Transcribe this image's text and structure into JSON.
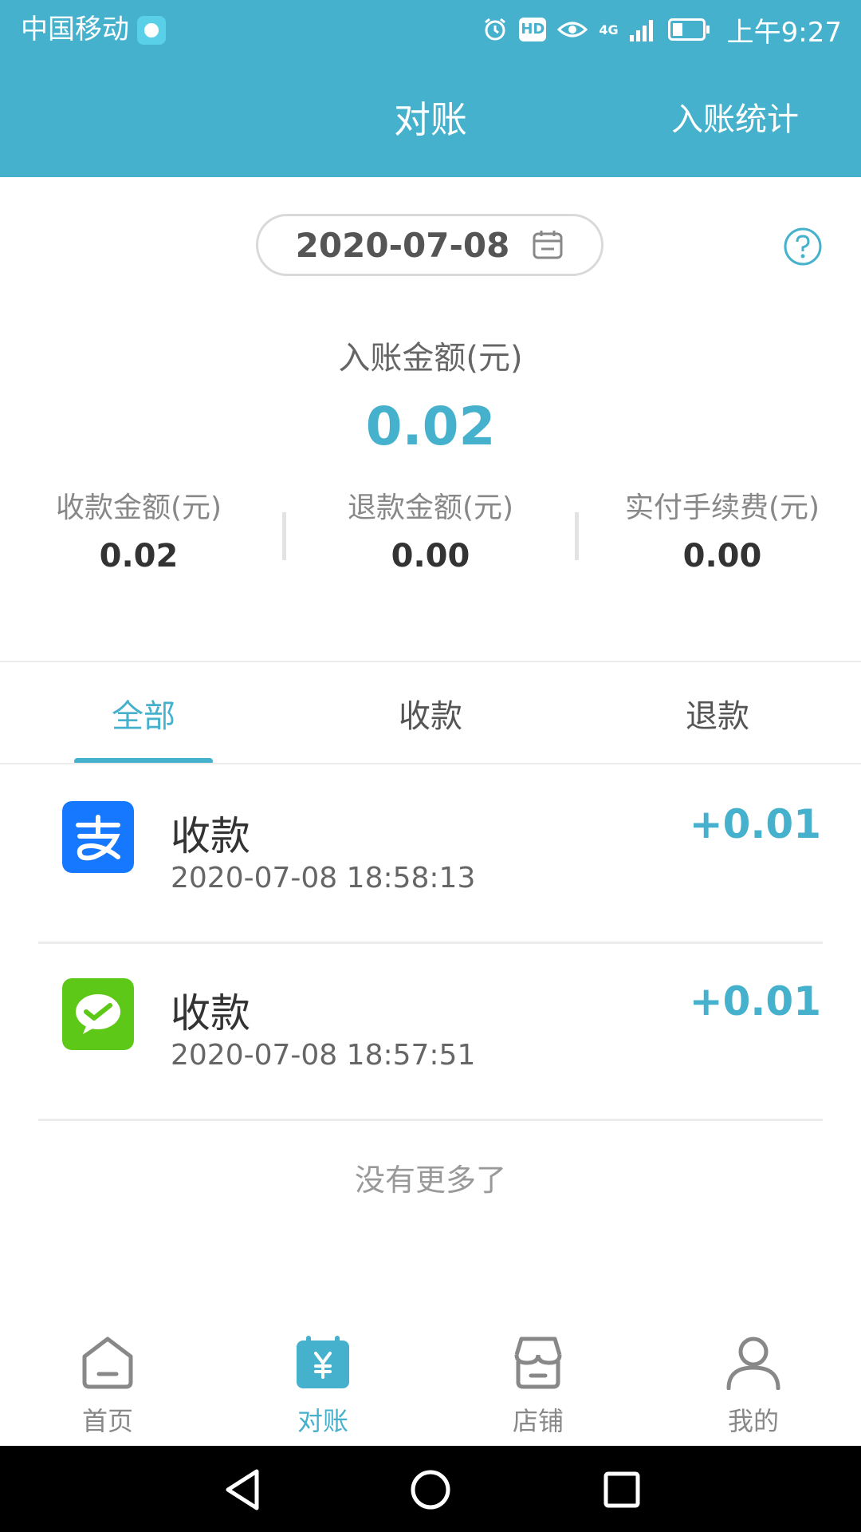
{
  "status_bar": {
    "carrier": "中国移动",
    "time": "上午9:27",
    "network": "4G",
    "hd": "HD"
  },
  "header": {
    "title": "对账",
    "stats_link": "入账统计"
  },
  "date": {
    "value": "2020-07-08"
  },
  "summary": {
    "label": "入账金额(元)",
    "value": "0.02",
    "stats": [
      {
        "label": "收款金额(元)",
        "value": "0.02"
      },
      {
        "label": "退款金额(元)",
        "value": "0.00"
      },
      {
        "label": "实付手续费(元)",
        "value": "0.00"
      }
    ]
  },
  "tabs": [
    {
      "label": "全部",
      "active": true
    },
    {
      "label": "收款",
      "active": false
    },
    {
      "label": "退款",
      "active": false
    }
  ],
  "transactions": [
    {
      "channel": "alipay-icon",
      "title": "收款",
      "time": "2020-07-08 18:58:13",
      "amount": "+0.01"
    },
    {
      "channel": "wechat-pay-icon",
      "title": "收款",
      "time": "2020-07-08 18:57:51",
      "amount": "+0.01"
    }
  ],
  "list_footer": "没有更多了",
  "bottom_nav": [
    {
      "label": "首页",
      "icon": "home-icon"
    },
    {
      "label": "对账",
      "icon": "reconciliation-icon",
      "active": true
    },
    {
      "label": "店铺",
      "icon": "store-icon"
    },
    {
      "label": "我的",
      "icon": "profile-icon"
    }
  ],
  "colors": {
    "accent": "#45b1cc",
    "alipay": "#1677ff",
    "wechat": "#5ec818"
  }
}
